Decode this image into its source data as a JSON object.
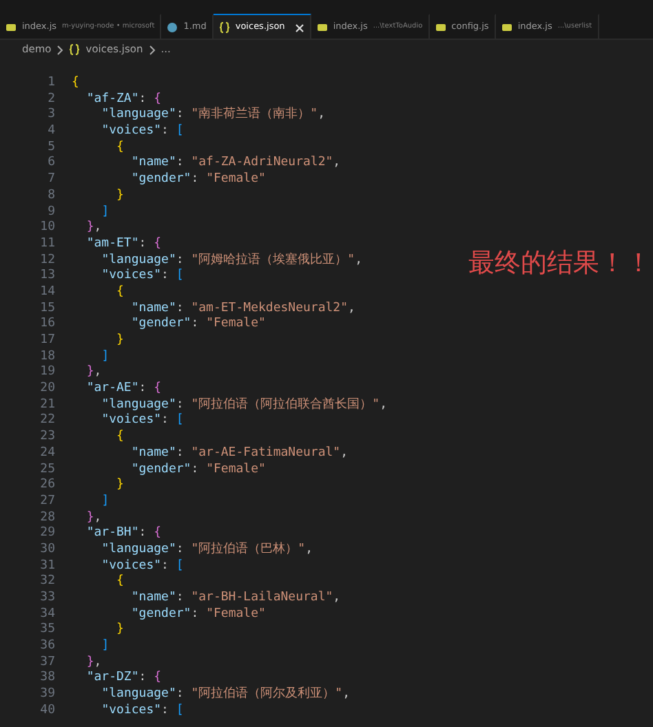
{
  "tabs": [
    {
      "kind": "js",
      "label": "index.js",
      "description": "m-yuying-node • microsoft",
      "selected": false
    },
    {
      "kind": "md",
      "label": "1.md",
      "selected": false
    },
    {
      "kind": "json",
      "label": "voices.json",
      "selected": true
    },
    {
      "kind": "js",
      "label": "index.js",
      "description": "...\\textToAudio",
      "selected": false
    },
    {
      "kind": "js",
      "label": "config.js",
      "selected": false
    },
    {
      "kind": "js",
      "label": "index.js",
      "description": "...\\userlist",
      "selected": false
    }
  ],
  "breadcrumb": {
    "folder": "demo",
    "file": "voices.json",
    "more": "..."
  },
  "lines": [
    {
      "number": "1",
      "text": "{"
    },
    {
      "number": "2",
      "text": "  \"af-ZA\": {"
    },
    {
      "number": "3",
      "text": "    \"language\": \"南非荷兰语（南非）\","
    },
    {
      "number": "4",
      "text": "    \"voices\": ["
    },
    {
      "number": "5",
      "text": "      {"
    },
    {
      "number": "6",
      "text": "        \"name\": \"af-ZA-AdriNeural2\","
    },
    {
      "number": "7",
      "text": "        \"gender\": \"Female\""
    },
    {
      "number": "8",
      "text": "      }"
    },
    {
      "number": "9",
      "text": "    ]"
    },
    {
      "number": "10",
      "text": "  },"
    },
    {
      "number": "11",
      "text": "  \"am-ET\": {"
    },
    {
      "number": "12",
      "text": "    \"language\": \"阿姆哈拉语（埃塞俄比亚）\","
    },
    {
      "number": "13",
      "text": "    \"voices\": ["
    },
    {
      "number": "14",
      "text": "      {"
    },
    {
      "number": "15",
      "text": "        \"name\": \"am-ET-MekdesNeural2\","
    },
    {
      "number": "16",
      "text": "        \"gender\": \"Female\""
    },
    {
      "number": "17",
      "text": "      }"
    },
    {
      "number": "18",
      "text": "    ]"
    },
    {
      "number": "19",
      "text": "  },"
    },
    {
      "number": "20",
      "text": "  \"ar-AE\": {"
    },
    {
      "number": "21",
      "text": "    \"language\": \"阿拉伯语（阿拉伯联合酋长国）\","
    },
    {
      "number": "22",
      "text": "    \"voices\": ["
    },
    {
      "number": "23",
      "text": "      {"
    },
    {
      "number": "24",
      "text": "        \"name\": \"ar-AE-FatimaNeural\","
    },
    {
      "number": "25",
      "text": "        \"gender\": \"Female\""
    },
    {
      "number": "26",
      "text": "      }"
    },
    {
      "number": "27",
      "text": "    ]"
    },
    {
      "number": "28",
      "text": "  },"
    },
    {
      "number": "29",
      "text": "  \"ar-BH\": {"
    },
    {
      "number": "30",
      "text": "    \"language\": \"阿拉伯语（巴林）\","
    },
    {
      "number": "31",
      "text": "    \"voices\": ["
    },
    {
      "number": "32",
      "text": "      {"
    },
    {
      "number": "33",
      "text": "        \"name\": \"ar-BH-LailaNeural\","
    },
    {
      "number": "34",
      "text": "        \"gender\": \"Female\""
    },
    {
      "number": "35",
      "text": "      }"
    },
    {
      "number": "36",
      "text": "    ]"
    },
    {
      "number": "37",
      "text": "  },"
    },
    {
      "number": "38",
      "text": "  \"ar-DZ\": {"
    },
    {
      "number": "39",
      "text": "    \"language\": \"阿拉伯语（阿尔及利亚）\","
    },
    {
      "number": "40",
      "text": "    \"voices\": ["
    }
  ],
  "annotation": "最终的结果！！"
}
